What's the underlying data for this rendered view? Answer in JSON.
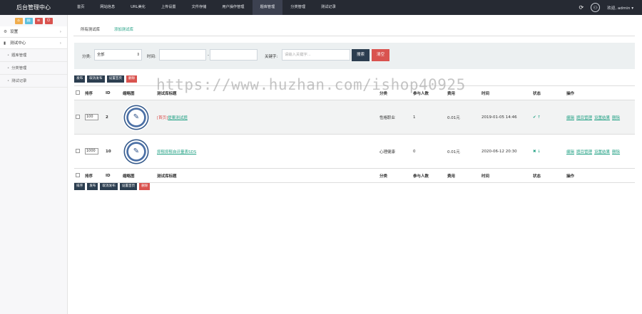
{
  "brand": "后台管理中心",
  "topnav": [
    "首页",
    "网站信息",
    "URL美化",
    "上传设置",
    "文件存储",
    "用户操作管理",
    "题库管理",
    "分类管理",
    "测试记录"
  ],
  "topnav_active": 6,
  "user": {
    "greeting": "欢迎, admin ▾"
  },
  "quick_buttons": [
    {
      "icon": "home-icon",
      "glyph": "⌂",
      "color": "#f0ad4e"
    },
    {
      "icon": "file-icon",
      "glyph": "▤",
      "color": "#5bc0de"
    },
    {
      "icon": "list-icon",
      "glyph": "≡",
      "color": "#d9534f"
    },
    {
      "icon": "power-icon",
      "glyph": "⏻",
      "color": "#d9534f"
    }
  ],
  "sidebar": {
    "groups": [
      {
        "label": "设置",
        "icon": "gear-icon",
        "glyph": "⚙"
      },
      {
        "label": "测试中心",
        "icon": "book-icon",
        "glyph": "▮"
      }
    ],
    "items": [
      "题库管理",
      "分类管理",
      "测试记录"
    ]
  },
  "tabs": [
    "所有测试库",
    "添加测试库"
  ],
  "filter": {
    "category_label": "分类:",
    "category_value": "全部",
    "time_label": "时间:",
    "time_sep": "-",
    "keyword_label": "关键字:",
    "keyword_placeholder": "请输入关键字...",
    "search": "搜索",
    "clear": "清空"
  },
  "actions_top": [
    "发布",
    "取消发布",
    "设置首页",
    "删除"
  ],
  "actions_bottom": [
    "排序",
    "发布",
    "取消发布",
    "设置首页",
    "删除"
  ],
  "columns": [
    "排序",
    "ID",
    "缩略图",
    "测试库标题",
    "分类",
    "参与人数",
    "费用",
    "时间",
    "状态",
    "操作"
  ],
  "rows": [
    {
      "sort": "100",
      "id": "2",
      "title_prefix": "[首页]",
      "title": "提案测试题",
      "category": "性格职业",
      "participants": "1",
      "fee": "0.01元",
      "time": "2019-01-05 14:46",
      "status": "✔ ↑",
      "ops": [
        "编辑",
        "题目管理",
        "设置结果",
        "删除"
      ]
    },
    {
      "sort": "1000",
      "id": "10",
      "title_prefix": "",
      "title": "抑郁抑郁自评量表SDS",
      "category": "心理健康",
      "participants": "0",
      "fee": "0.01元",
      "time": "2020-06-12 20:30",
      "status": "✖ ↓",
      "ops": [
        "编辑",
        "题目管理",
        "设置结果",
        "删除"
      ]
    }
  ],
  "watermark": "https://www.huzhan.com/ishop40925"
}
